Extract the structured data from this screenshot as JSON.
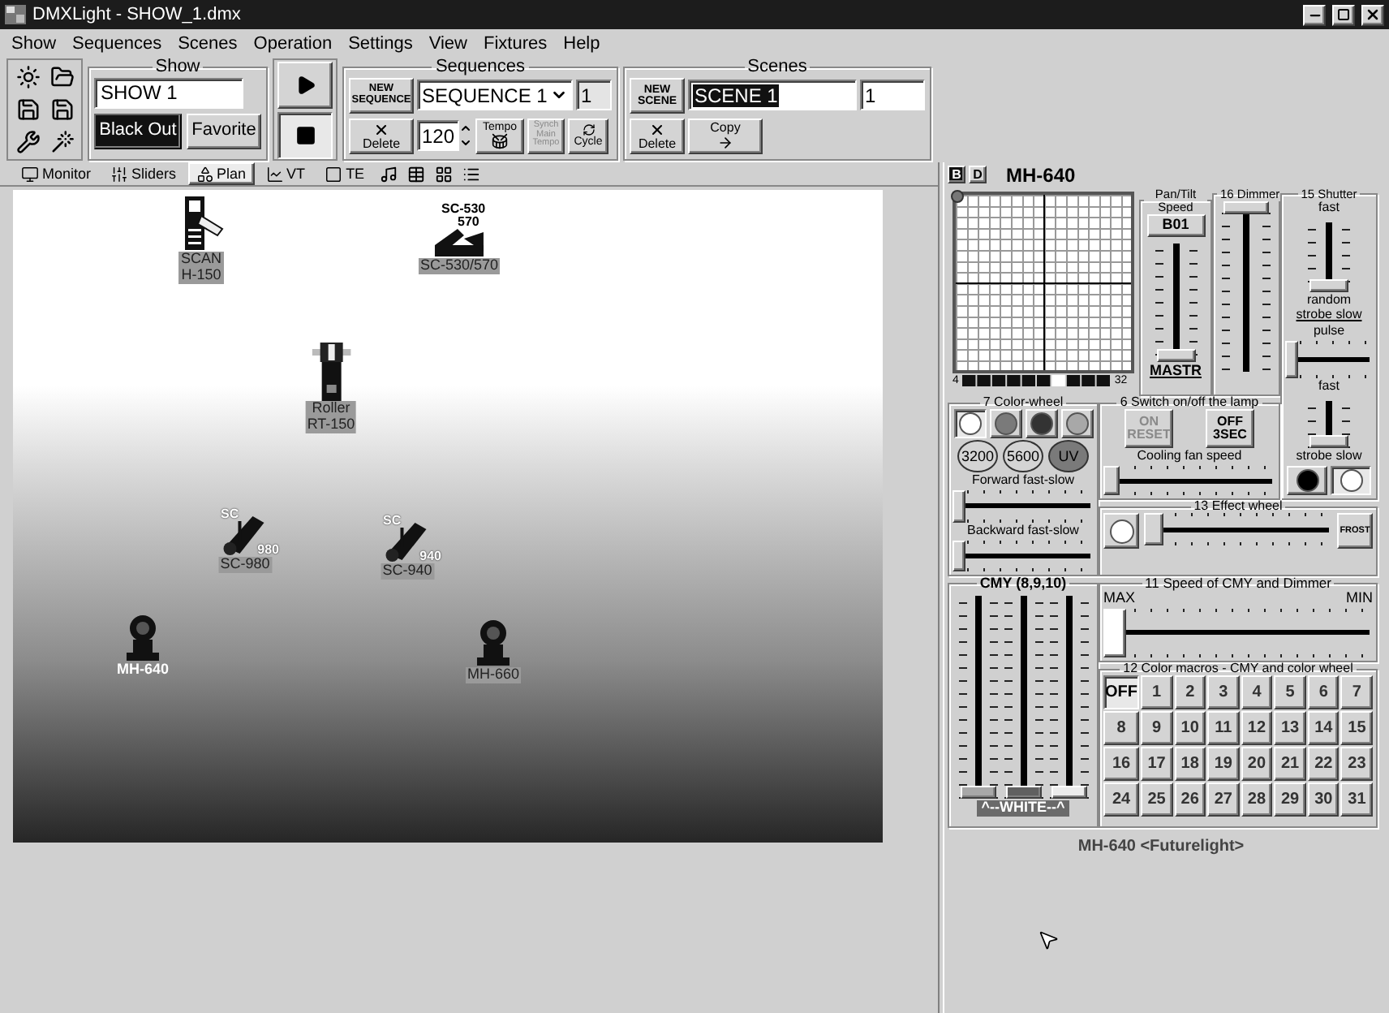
{
  "window": {
    "title": "DMXLight - SHOW_1.dmx"
  },
  "menu": [
    "Show",
    "Sequences",
    "Scenes",
    "Operation",
    "Settings",
    "View",
    "Fixtures",
    "Help"
  ],
  "show": {
    "legend": "Show",
    "name": "SHOW 1",
    "blackout": {
      "label": "Black Out",
      "on": true
    },
    "favorite": "Favorite"
  },
  "transport": [
    {
      "kind": "play",
      "pressed": false
    },
    {
      "kind": "stop",
      "pressed": true
    }
  ],
  "sequences": {
    "legend": "Sequences",
    "new_label": "NEW SEQUENCE",
    "selected": "SEQUENCE 1",
    "number": "1",
    "delete": "Delete",
    "tempo_value": "120",
    "tempo": "Tempo",
    "synch": {
      "label": "Synch Main Tempo",
      "disabled": true
    },
    "cycle": "Cycle"
  },
  "scenes": {
    "legend": "Scenes",
    "new_label": "NEW SCENE",
    "name": "SCENE 1",
    "number": "1",
    "delete": "Delete",
    "copy": "Copy"
  },
  "tabs": [
    {
      "label": "Monitor",
      "kind": "monitor",
      "selected": false
    },
    {
      "label": "Sliders",
      "kind": "sliders",
      "selected": false
    },
    {
      "label": "Plan",
      "kind": "plan",
      "selected": true
    },
    {
      "label": "VT",
      "kind": "vt",
      "selected": false
    },
    {
      "label": "TE",
      "kind": "te",
      "selected": false
    }
  ],
  "plan": {
    "fixtures": [
      {
        "label": "SCAN H-150",
        "kind": "scanner",
        "selected": false
      },
      {
        "label": "SC-530/570",
        "kind": "twin-scanner",
        "icon_text": [
          "SC-530",
          "570"
        ],
        "selected": false
      },
      {
        "label": "Roller RT-150",
        "kind": "roller",
        "selected": false
      },
      {
        "label": "SC-980",
        "kind": "sc-scanner",
        "icon_text": [
          "SC",
          "980"
        ],
        "selected": false
      },
      {
        "label": "SC-940",
        "kind": "sc-scanner",
        "icon_text": [
          "SC",
          "940"
        ],
        "selected": false
      },
      {
        "label": "MH-640",
        "kind": "moving-head",
        "selected": true
      },
      {
        "label": "MH-660",
        "kind": "moving-head",
        "selected": false
      }
    ]
  },
  "panel": {
    "mode_tabs": [
      {
        "label": "B",
        "selected": true
      },
      {
        "label": "D",
        "selected": false
      }
    ],
    "fixture_name": "MH-640",
    "xy_pad": {
      "scale_start": "4",
      "scale_end": "32"
    },
    "pan_tilt": {
      "legend": "Pan/Tilt Speed",
      "button": "B01",
      "level": 0,
      "footer": "MASTR"
    },
    "dimmer": {
      "legend": "16 Dimmer",
      "level": 1
    },
    "shutter": {
      "legend": "15 Shutter",
      "top_label": "fast",
      "upper": {
        "level": 0
      },
      "random": "random",
      "strobe_link": "strobe slow",
      "pulse": "pulse",
      "pulse_slider": {
        "level": 0
      },
      "fast": "fast",
      "lower": {
        "level": 0
      },
      "bottom_label": "strobe slow",
      "buttons": [
        {
          "color": "#000000",
          "selected": false
        },
        {
          "color": "#ffffff",
          "selected": true
        }
      ]
    },
    "color_wheel": {
      "legend": "7 Color-wheel",
      "colors": [
        {
          "color": "#ffffff",
          "selected": true
        },
        {
          "color": "#7a7a7a",
          "selected": false
        },
        {
          "color": "#333333",
          "selected": false
        },
        {
          "color": "#a8a8a8",
          "selected": false
        }
      ],
      "filters": [
        {
          "label": "3200",
          "color": "#d4d4d4"
        },
        {
          "label": "5600",
          "color": "#d4d4d4"
        },
        {
          "label": "UV",
          "color": "#7a7a7a"
        }
      ],
      "forward": {
        "label": "Forward fast-slow",
        "level": 0
      },
      "backward": {
        "label": "Backward fast-slow",
        "level": 0
      }
    },
    "lamp": {
      "legend": "6 Switch on/off the lamp",
      "on": {
        "label": "ON",
        "sub": "RESET",
        "disabled": true
      },
      "off": {
        "label": "OFF",
        "sub": "3SEC",
        "disabled": false
      },
      "fan": {
        "label": "Cooling fan speed",
        "level": 0
      }
    },
    "effect_wheel": {
      "legend": "13 Effect wheel",
      "level": 0,
      "frost": "FROST"
    },
    "cmy": {
      "legend": "CMY (8,9,10)",
      "channels": [
        {
          "level": 0,
          "color": "#a8a8a8"
        },
        {
          "level": 0,
          "color": "#606060"
        },
        {
          "level": 0,
          "color": "#ececec"
        }
      ],
      "footer": "^--WHITE--^"
    },
    "speed": {
      "legend": "11 Speed of CMY and Dimmer",
      "max": "MAX",
      "min": "MIN",
      "level": 0
    },
    "macros": {
      "legend": "12 Color macros - CMY and color wheel",
      "items": [
        {
          "label": "OFF",
          "selected": true
        },
        {
          "label": "1",
          "selected": false
        },
        {
          "label": "2",
          "selected": false
        },
        {
          "label": "3",
          "selected": false
        },
        {
          "label": "4",
          "selected": false
        },
        {
          "label": "5",
          "selected": false
        },
        {
          "label": "6",
          "selected": false
        },
        {
          "label": "7",
          "selected": false
        },
        {
          "label": "8",
          "selected": false
        },
        {
          "label": "9",
          "selected": false
        },
        {
          "label": "10",
          "selected": false
        },
        {
          "label": "11",
          "selected": false
        },
        {
          "label": "12",
          "selected": false
        },
        {
          "label": "13",
          "selected": false
        },
        {
          "label": "14",
          "selected": false
        },
        {
          "label": "15",
          "selected": false
        },
        {
          "label": "16",
          "selected": false
        },
        {
          "label": "17",
          "selected": false
        },
        {
          "label": "18",
          "selected": false
        },
        {
          "label": "19",
          "selected": false
        },
        {
          "label": "20",
          "selected": false
        },
        {
          "label": "21",
          "selected": false
        },
        {
          "label": "22",
          "selected": false
        },
        {
          "label": "23",
          "selected": false
        },
        {
          "label": "24",
          "selected": false
        },
        {
          "label": "25",
          "selected": false
        },
        {
          "label": "26",
          "selected": false
        },
        {
          "label": "27",
          "selected": false
        },
        {
          "label": "28",
          "selected": false
        },
        {
          "label": "29",
          "selected": false
        },
        {
          "label": "30",
          "selected": false
        },
        {
          "label": "31",
          "selected": false
        }
      ]
    },
    "footer": "MH-640 <Futurelight>"
  }
}
